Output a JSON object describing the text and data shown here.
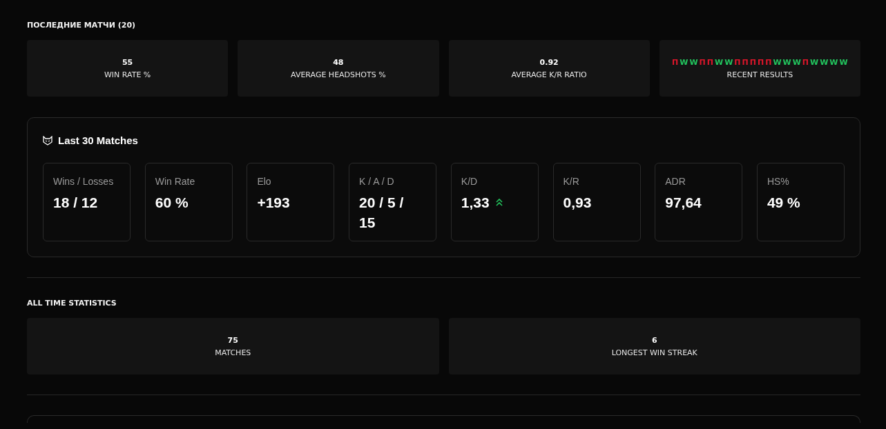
{
  "recent": {
    "title": "ПОСЛЕДНИЕ МАТЧИ (20)",
    "stats": [
      {
        "value": "55",
        "label": "WIN RATE %"
      },
      {
        "value": "48",
        "label": "AVERAGE HEADSHOTS %"
      },
      {
        "value": "0.92",
        "label": "AVERAGE K/R RATIO"
      }
    ],
    "results": {
      "label": "RECENT RESULTS",
      "items": [
        {
          "letter": "П",
          "color": "#e0162b"
        },
        {
          "letter": "W",
          "color": "#22c55e"
        },
        {
          "letter": "W",
          "color": "#22c55e"
        },
        {
          "letter": "П",
          "color": "#e0162b"
        },
        {
          "letter": "П",
          "color": "#e0162b"
        },
        {
          "letter": "W",
          "color": "#22c55e"
        },
        {
          "letter": "W",
          "color": "#22c55e"
        },
        {
          "letter": "П",
          "color": "#e0162b"
        },
        {
          "letter": "П",
          "color": "#e0162b"
        },
        {
          "letter": "П",
          "color": "#e0162b"
        },
        {
          "letter": "П",
          "color": "#e0162b"
        },
        {
          "letter": "П",
          "color": "#e0162b"
        },
        {
          "letter": "W",
          "color": "#22c55e"
        },
        {
          "letter": "W",
          "color": "#22c55e"
        },
        {
          "letter": "W",
          "color": "#22c55e"
        },
        {
          "letter": "П",
          "color": "#e0162b"
        },
        {
          "letter": "W",
          "color": "#22c55e"
        },
        {
          "letter": "W",
          "color": "#22c55e"
        },
        {
          "letter": "W",
          "color": "#22c55e"
        },
        {
          "letter": "W",
          "color": "#22c55e"
        }
      ]
    }
  },
  "last_matches": {
    "title": "Last 30 Matches",
    "tiles": [
      {
        "label": "Wins / Losses",
        "value": "18 / 12",
        "trend_up": false
      },
      {
        "label": "Win Rate",
        "value": "60 %",
        "trend_up": false
      },
      {
        "label": "Elo",
        "value": "+193",
        "trend_up": false
      },
      {
        "label": "K / A / D",
        "value": "20 / 5 / 15",
        "trend_up": false
      },
      {
        "label": "K/D",
        "value": "1,33",
        "trend_up": true
      },
      {
        "label": "K/R",
        "value": "0,93",
        "trend_up": false
      },
      {
        "label": "ADR",
        "value": "97,64",
        "trend_up": false
      },
      {
        "label": "HS%",
        "value": "49 %",
        "trend_up": false
      }
    ]
  },
  "all_time": {
    "title": "ALL TIME STATISTICS",
    "stats": [
      {
        "value": "75",
        "label": "MATCHES"
      },
      {
        "value": "6",
        "label": "LONGEST WIN STREAK"
      }
    ]
  }
}
